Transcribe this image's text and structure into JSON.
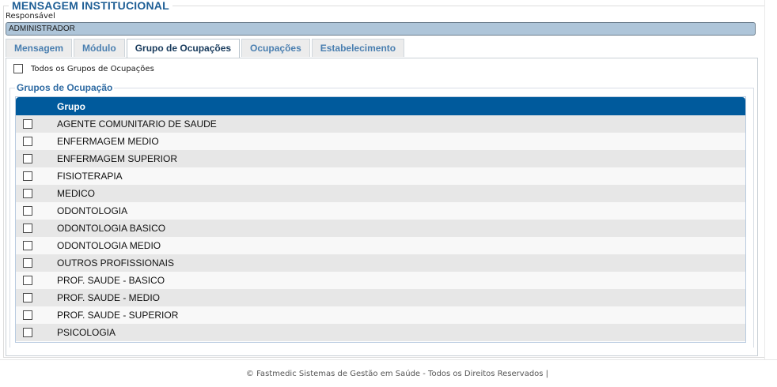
{
  "section": {
    "title": "MENSAGEM INSTITUCIONAL",
    "responsavel_label": "Responsável",
    "responsavel_value": "ADMINISTRADOR"
  },
  "tabs": [
    {
      "label": "Mensagem",
      "active": false
    },
    {
      "label": "Módulo",
      "active": false
    },
    {
      "label": "Grupo de Ocupações",
      "active": true
    },
    {
      "label": "Ocupações",
      "active": false
    },
    {
      "label": "Estabelecimento",
      "active": false
    }
  ],
  "panel": {
    "all_groups_label": "Todos os Grupos de Ocupações",
    "groups_legend": "Grupos de Ocupação",
    "grid": {
      "header": "Grupo",
      "rows": [
        "AGENTE COMUNITARIO DE SAUDE",
        "ENFERMAGEM MEDIO",
        "ENFERMAGEM SUPERIOR",
        "FISIOTERAPIA",
        "MEDICO",
        "ODONTOLOGIA",
        "ODONTOLOGIA BASICO",
        "ODONTOLOGIA MEDIO",
        "OUTROS PROFISSIONAIS",
        "PROF. SAUDE - BASICO",
        "PROF. SAUDE - MEDIO",
        "PROF. SAUDE - SUPERIOR",
        "PSICOLOGIA"
      ]
    }
  },
  "footer": {
    "text": "© Fastmedic Sistemas de Gestão em Saúde - Todos os Direitos Reservados |"
  },
  "colors": {
    "header_blue": "#005a9c",
    "legend_blue": "#1f5f96",
    "input_bg": "#aec5d9"
  }
}
